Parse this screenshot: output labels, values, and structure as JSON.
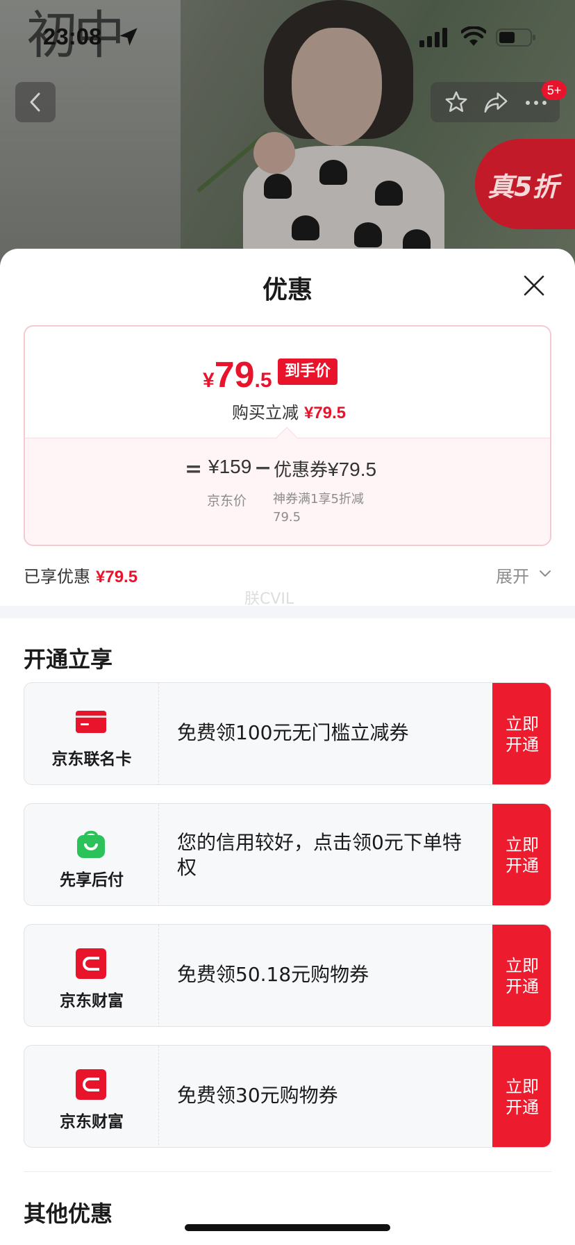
{
  "status_bar": {
    "time": "23:08"
  },
  "brand_mark": "初中",
  "hero": {
    "cart_badge": "5+",
    "promo_badge": "真5折"
  },
  "sheet": {
    "title": "优惠",
    "price_card": {
      "currency": "¥",
      "final_price_int": "79",
      "final_price_dec": ".5",
      "final_price_tag": "到手价",
      "instant_cut_label": "购买立减",
      "instant_cut_amount": "¥79.5",
      "formula_equals": "=",
      "base_price": "¥159",
      "formula_minus": "−",
      "coupon_label": "优惠券",
      "coupon_amount": "¥79.5",
      "base_price_label": "京东价",
      "coupon_desc": "神券满1享5折减79.5"
    },
    "enjoyed_label": "已享优惠",
    "enjoyed_amount": "¥79.5",
    "expand_label": "展开",
    "watermark": "朕CVIL",
    "section_open_title": "开通立享",
    "offers": [
      {
        "brand": "京东联名卡",
        "desc": "免费领100元无门槛立减券",
        "action": "立即开通",
        "color": "#e8142c"
      },
      {
        "brand": "先享后付",
        "desc": "您的信用较好，点击领0元下单特权",
        "action": "立即开通",
        "color": "#2bc25a"
      },
      {
        "brand": "京东财富",
        "desc": "免费领50.18元购物券",
        "action": "立即开通",
        "color": "#e8142c"
      },
      {
        "brand": "京东财富",
        "desc": "免费领30元购物券",
        "action": "立即开通",
        "color": "#e8142c"
      }
    ],
    "section_other_title": "其他优惠"
  }
}
